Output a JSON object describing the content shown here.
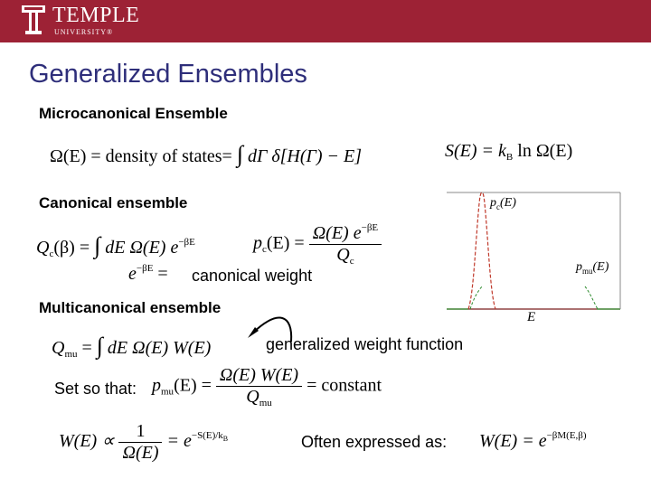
{
  "header": {
    "brand": "TEMPLE",
    "subbrand": "UNIVERSITY®",
    "logo_icon": "temple-t-logo-icon",
    "colors": {
      "banner": "#9d2235",
      "title": "#2e2e7a"
    }
  },
  "slide": {
    "title": "Generalized Ensembles",
    "sections": {
      "micro": {
        "heading": "Microcanonical Ensemble",
        "eq1": {
          "lhs": "Ω(E) = density of states= ",
          "integral": "∫",
          "rhs": " dΓ δ[H(Γ) − E]"
        },
        "eq2": "S(E) = k",
        "eq2_sub": "B",
        "eq2_rest": " ln Ω(E)"
      },
      "canonical": {
        "heading": "Canonical ensemble",
        "eq1_lhs": "Q",
        "eq1_sub": "c",
        "eq1_mid": "(β) = ",
        "eq1_int": "∫",
        "eq1_rhs": " dE Ω(E) e",
        "eq1_sup": "−βE",
        "eq2_lhs": "p",
        "eq2_sub": "c",
        "eq2_mid": "(E) = ",
        "eq2_num": "Ω(E) e",
        "eq2_num_sup": "−βE",
        "eq2_den": "Q",
        "eq2_den_sub": "c",
        "weight_expr": "e",
        "weight_sup": "−βE",
        "weight_eq": " = ",
        "weight_label": "canonical weight"
      },
      "multi": {
        "heading": "Multicanonical ensemble",
        "eq1_lhs": "Q",
        "eq1_sub": "mu",
        "eq1_eq": " = ",
        "eq1_int": "∫",
        "eq1_rhs": " dE Ω(E) W(E)",
        "annotation": "generalized weight function",
        "set_label": "Set so that:",
        "eq2_lhs": "p",
        "eq2_sub": "mu",
        "eq2_mid": "(E) = ",
        "eq2_num": "Ω(E) W(E)",
        "eq2_den": "Q",
        "eq2_den_sub": "mu",
        "eq2_rhs": " = constant",
        "eq3_lhs": "W(E) ∝ ",
        "eq3_num": "1",
        "eq3_den": "Ω(E)",
        "eq3_eq": " = e",
        "eq3_sup": "−S(E)/k",
        "eq3_sup_sub": "B",
        "often_label": "Often expressed as:",
        "eq4_lhs": "W(E) = e",
        "eq4_sup": "−βM(E,β)"
      }
    },
    "plot": {
      "xlabel": "E",
      "label_c": "p",
      "label_c_sub": "c",
      "label_c_arg": "(E)",
      "label_mu": "p",
      "label_mu_sub": "mu",
      "label_mu_arg": "(E)",
      "colors": {
        "canonical": "#c0392b",
        "multicanonical": "#2e8b2e",
        "axis": "#888888",
        "baseline": "#7a1f1f"
      }
    }
  }
}
